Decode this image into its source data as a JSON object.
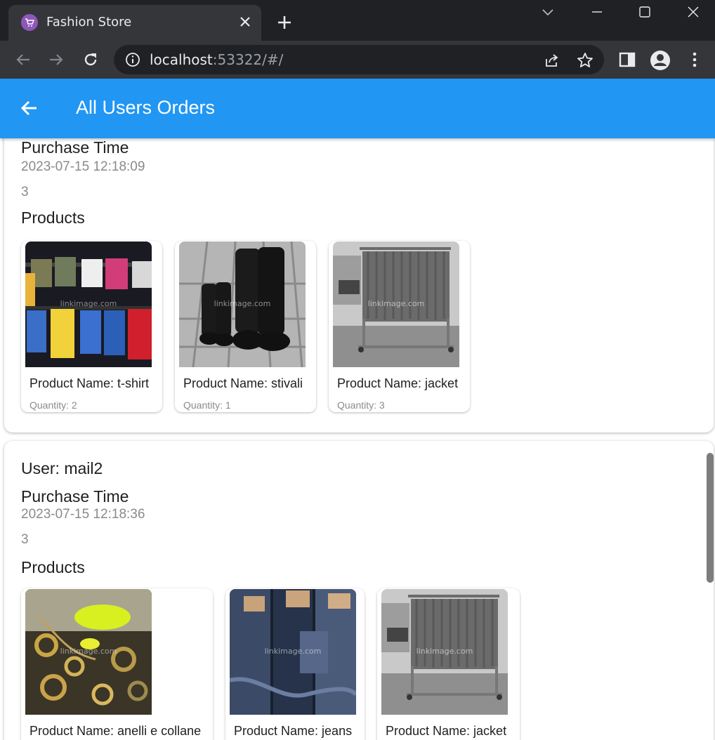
{
  "browser": {
    "tab_title": "Fashion Store",
    "url_host": "localhost",
    "url_rest": ":53322/#/"
  },
  "appbar": {
    "title": "All Users Orders"
  },
  "orders": [
    {
      "purchase_label": "Purchase Time",
      "time": "2023-07-15 12:18:09",
      "count": "3",
      "products_label": "Products",
      "products": [
        {
          "name": "Product Name: t-shirt",
          "qty": "Quantity: 2",
          "image": "t-shirts-photo"
        },
        {
          "name": "Product Name: stivali",
          "qty": "Quantity: 1",
          "image": "boots-photo"
        },
        {
          "name": "Product Name: jacket",
          "qty": "Quantity: 3",
          "image": "clothes-rack-photo"
        }
      ]
    },
    {
      "user": "User: mail2",
      "purchase_label": "Purchase Time",
      "time": "2023-07-15 12:18:36",
      "count": "3",
      "products_label": "Products",
      "products": [
        {
          "name": "Product Name: anelli e collane",
          "image": "jewelry-photo"
        },
        {
          "name": "Product Name: jeans",
          "image": "jeans-photo"
        },
        {
          "name": "Product Name: jacket",
          "image": "clothes-rack-photo"
        }
      ]
    }
  ],
  "colors": {
    "appbar": "#2196f3",
    "browser_dark": "#202124",
    "browser_toolbar": "#35363a"
  }
}
